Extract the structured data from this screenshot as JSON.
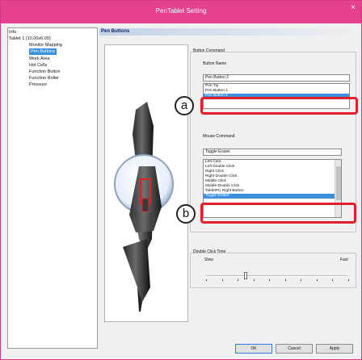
{
  "window": {
    "title": "PenTablet Setting",
    "close_glyph": "×"
  },
  "tree": {
    "items": [
      {
        "label": "Info",
        "selected": false
      },
      {
        "label": "Tablet 1 (10.00x6.00)",
        "selected": false
      },
      {
        "label": "Monitor Mapping",
        "selected": false
      },
      {
        "label": "Pen Buttons",
        "selected": true
      },
      {
        "label": "Work Area",
        "selected": false
      },
      {
        "label": "Hot Cells",
        "selected": false
      },
      {
        "label": "Function Button",
        "selected": false
      },
      {
        "label": "Function Roller",
        "selected": false
      },
      {
        "label": "Pressure",
        "selected": false
      }
    ]
  },
  "section": {
    "title": "Pen Buttons"
  },
  "button_command": {
    "group_label": "Button Command",
    "name_label": "Button Name",
    "selected_value": "Pen Button 2",
    "options": [
      "Pen Tip",
      "Pen Button 1",
      "Pen Button 2"
    ],
    "highlighted_option": "Pen Button 2"
  },
  "mouse_command": {
    "group_label": "Mouse Command",
    "selected_value": "Toggle Eraser",
    "options": [
      "Left Click",
      "Left Double Click",
      "Right Click",
      "Right Double Click",
      "Middle Click",
      "Middle Double Click",
      "TabletPC Right Button",
      "Toggle Eraser"
    ],
    "highlighted_option": "Toggle Eraser"
  },
  "double_click": {
    "group_label": "Double Click Time",
    "slow_label": "Slow",
    "fast_label": "Fast",
    "position": 0.28
  },
  "callouts": {
    "a": "a",
    "b": "b"
  },
  "buttons": {
    "ok": "OK",
    "cancel": "Cancel",
    "apply": "Apply"
  },
  "colors": {
    "title_bar": "#e5418f",
    "highlight": "#3b8fdc",
    "callout_box": "#e0202a"
  }
}
